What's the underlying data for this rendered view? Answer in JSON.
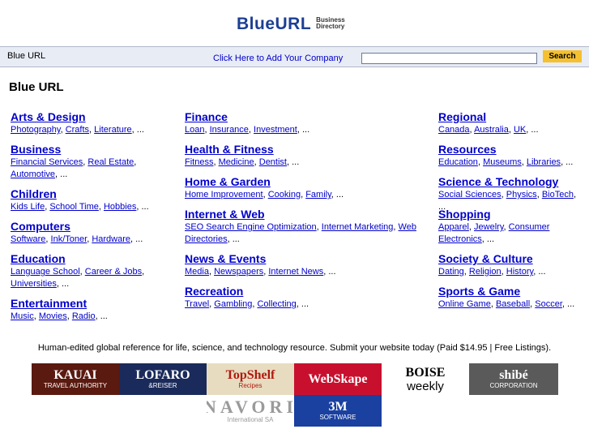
{
  "logo": {
    "main": "BlueURL",
    "line1": "Business",
    "line2": "Directory"
  },
  "bar": {
    "home": "Blue URL",
    "add_link": "Click Here to Add Your Company",
    "search_button": "Search",
    "search_value": ""
  },
  "page_title": "Blue URL",
  "columns": [
    [
      {
        "title": "Arts & Design",
        "subs": [
          "Photography",
          "Crafts",
          "Literature"
        ]
      },
      {
        "title": "Business",
        "subs": [
          "Financial Services",
          "Real Estate",
          "Automotive"
        ],
        "tall": true
      },
      {
        "title": "Children",
        "subs": [
          "Kids Life",
          "School Time",
          "Hobbies"
        ]
      },
      {
        "title": "Computers",
        "subs": [
          "Software",
          "Ink/Toner",
          "Hardware"
        ]
      },
      {
        "title": "Education",
        "subs": [
          "Language School",
          "Career & Jobs",
          "Universities"
        ],
        "tall": true
      },
      {
        "title": "Entertainment",
        "subs": [
          "Music",
          "Movies",
          "Radio"
        ]
      }
    ],
    [
      {
        "title": "Finance",
        "subs": [
          "Loan",
          "Insurance",
          "Investment"
        ]
      },
      {
        "title": "Health & Fitness",
        "subs": [
          "Fitness",
          "Medicine",
          "Dentist"
        ]
      },
      {
        "title": "Home & Garden",
        "subs": [
          "Home Improvement",
          "Cooking",
          "Family"
        ]
      },
      {
        "title": "Internet & Web",
        "subs": [
          "SEO Search Engine Optimization",
          "Internet Marketing",
          "Web Directories"
        ],
        "tall": true
      },
      {
        "title": "News & Events",
        "subs": [
          "Media",
          "Newspapers",
          "Internet News"
        ]
      },
      {
        "title": "Recreation",
        "subs": [
          "Travel",
          "Gambling",
          "Collecting"
        ]
      }
    ],
    [
      {
        "title": "Regional",
        "subs": [
          "Canada",
          "Australia",
          "UK"
        ]
      },
      {
        "title": "Resources",
        "subs": [
          "Education",
          "Museums",
          "Libraries"
        ]
      },
      {
        "title": "Science & Technology",
        "subs": [
          "Social Sciences",
          "Physics",
          "BioTech"
        ]
      },
      {
        "title": "Shopping",
        "subs": [
          "Apparel",
          "Jewelry",
          "Consumer Electronics"
        ],
        "tall": true
      },
      {
        "title": "Society & Culture",
        "subs": [
          "Dating",
          "Religion",
          "History"
        ]
      },
      {
        "title": "Sports & Game",
        "subs": [
          "Online Game",
          "Baseball",
          "Soccer"
        ]
      }
    ]
  ],
  "ellipsis": "...",
  "description": {
    "text": "Human-edited global reference for life, science, and technology resource. Submit your website today (Paid $14.95 | ",
    "link": "Free Listings",
    "end": ")."
  },
  "banners": [
    {
      "name": "kauai",
      "text": "KAUAI",
      "sub": "TRAVEL AUTHORITY",
      "bg": "#5a1a10",
      "fg": "#ffffff"
    },
    {
      "name": "lofaro-reiser",
      "text": "LOFARO",
      "sub": "&REISER",
      "bg": "#1a2a5a",
      "fg": "#ffffff"
    },
    {
      "name": "topshelf-recipes",
      "text": "TopShelf",
      "sub": "Recipes",
      "bg": "#e8dcc0",
      "fg": "#b01a10"
    },
    {
      "name": "webskape",
      "text": "WebSkape",
      "sub": "",
      "bg": "#c8102e",
      "fg": "#ffffff"
    },
    {
      "name": "boise-weekly",
      "text": "BOISE",
      "sub": "weekly",
      "bg": "#ffffff",
      "fg": "#000000"
    },
    {
      "name": "shibe-corporation",
      "text": "shibé",
      "sub": "CORPORATION",
      "bg": "#5a5a5a",
      "fg": "#ffffff"
    },
    {
      "name": "navori",
      "text": "NAVORI",
      "sub": "International SA",
      "bg": "#ffffff",
      "fg": "#9a9a9a"
    },
    {
      "name": "3m-software",
      "text": "3M",
      "sub": "SOFTWARE",
      "bg": "#1a40a0",
      "fg": "#ffffff"
    }
  ]
}
